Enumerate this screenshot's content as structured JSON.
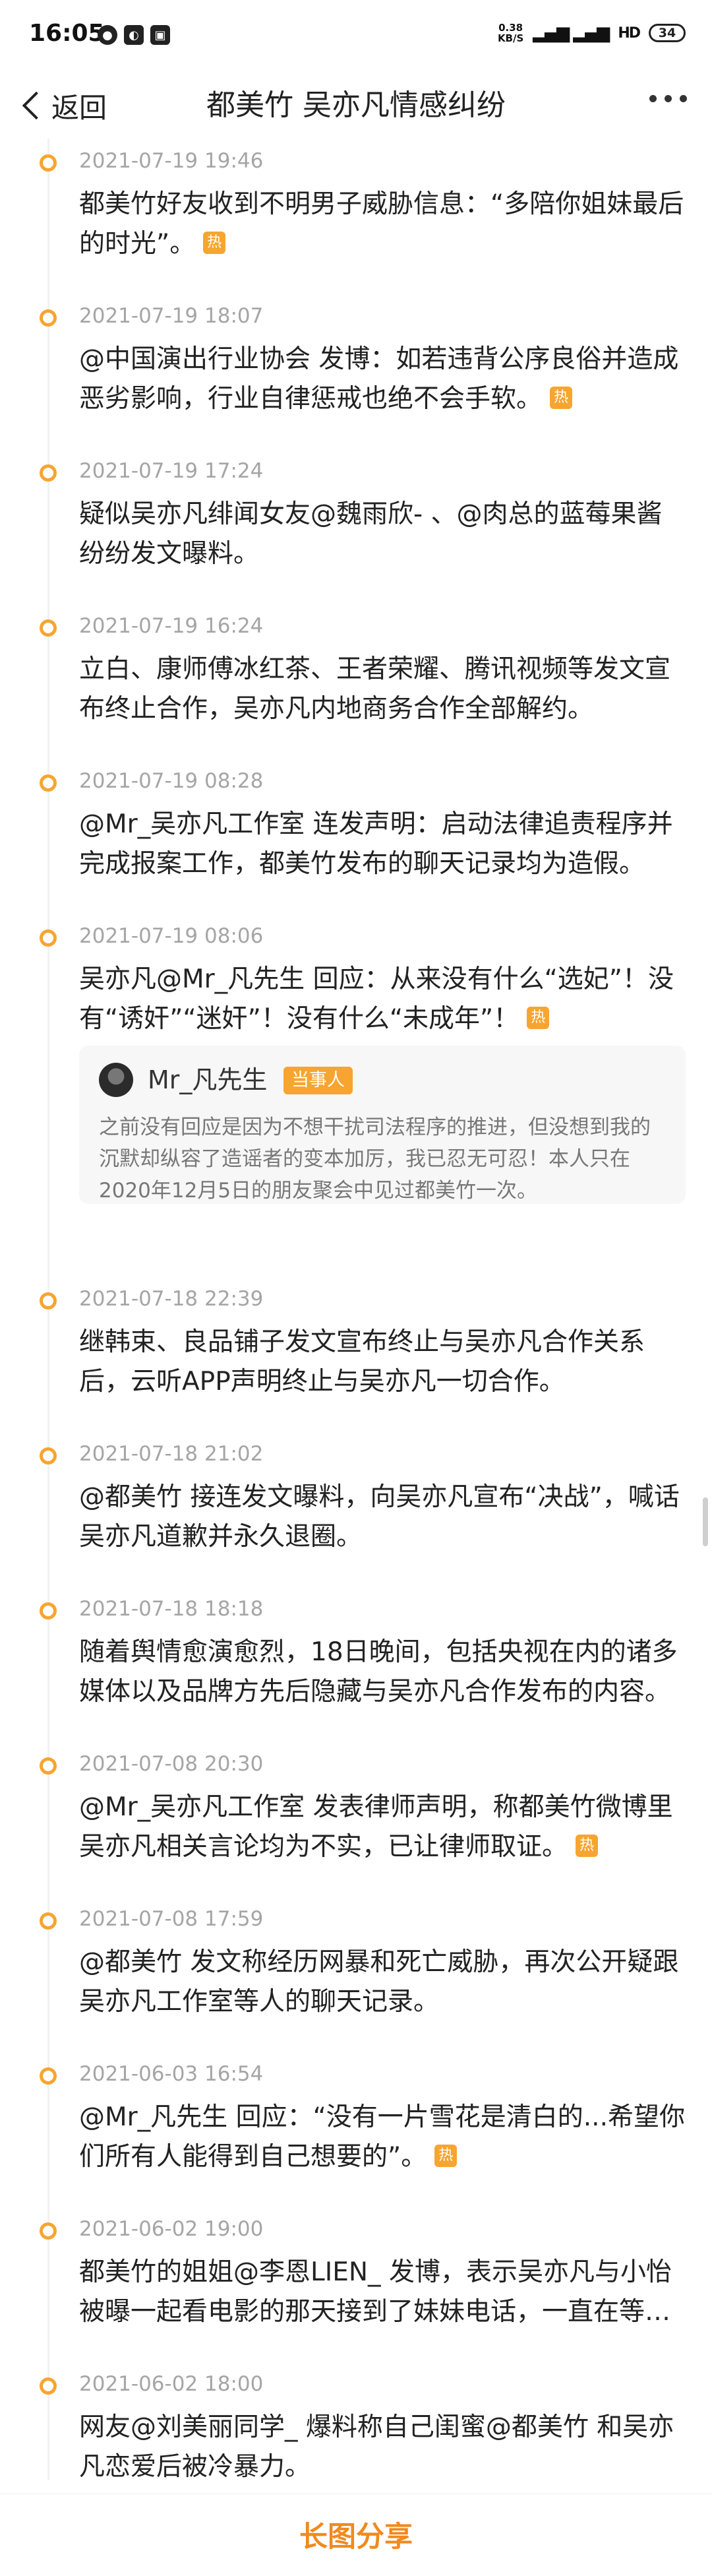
{
  "status_bar": {
    "time": "16:05",
    "left_icons": [
      "message-icon",
      "dnd-icon",
      "app-icon"
    ],
    "speed_value": "0.38",
    "speed_unit": "KB/S",
    "signal": "4G 4G",
    "wifi_label": "HD",
    "battery": "34"
  },
  "nav": {
    "back_label": "返回",
    "title": "都美竹 吴亦凡情感纠纷"
  },
  "hot_label": "热",
  "timeline": [
    {
      "time": "2021-07-19 19:46",
      "text": "都美竹好友收到不明男子威胁信息：“多陪你姐妹最后的时光”。",
      "hot": true
    },
    {
      "time": "2021-07-19 18:07",
      "text": "@中国演出行业协会 发博：如若违背公序良俗并造成恶劣影响，行业自律惩戒也绝不会手软。",
      "hot": true
    },
    {
      "time": "2021-07-19 17:24",
      "text": "疑似吴亦凡绯闻女友@魏雨欣- 、@肉总的蓝莓果酱 纷纷发文曝料。",
      "hot": false
    },
    {
      "time": "2021-07-19 16:24",
      "text": "立白、康师傅冰红茶、王者荣耀、腾讯视频等发文宣布终止合作，吴亦凡内地商务合作全部解约。",
      "hot": false
    },
    {
      "time": "2021-07-19 08:28",
      "text": "@Mr_吴亦凡工作室 连发声明：启动法律追责程序并完成报案工作，都美竹发布的聊天记录均为造假。",
      "hot": false
    },
    {
      "time": "2021-07-19 08:06",
      "text": "吴亦凡@Mr_凡先生 回应：从来没有什么“选妃”！没有“诱奸”“迷奸”！没有什么“未成年”！",
      "hot": true,
      "quote": {
        "name": "Mr_凡先生",
        "badge": "当事人",
        "text": "之前没有回应是因为不想干扰司法程序的推进，但没想到我的沉默却纵容了造谣者的变本加厉，我已忍无可忍！本人只在2020年12月5日的朋友聚会中见过都美竹一次。"
      }
    },
    {
      "time": "2021-07-18 22:39",
      "text": "继韩束、良品铺子发文宣布终止与吴亦凡合作关系后，云听APP声明终止与吴亦凡一切合作。",
      "hot": false
    },
    {
      "time": "2021-07-18 21:02",
      "text": "@都美竹 接连发文曝料，向吴亦凡宣布“决战”，喊话吴亦凡道歉并永久退圈。",
      "hot": false
    },
    {
      "time": "2021-07-18 18:18",
      "text": "随着舆情愈演愈烈，18日晚间，包括央视在内的诸多媒体以及品牌方先后隐藏与吴亦凡合作发布的内容。",
      "hot": false
    },
    {
      "time": "2021-07-08 20:30",
      "text": "@Mr_吴亦凡工作室 发表律师声明，称都美竹微博里吴亦凡相关言论均为不实，已让律师取证。",
      "hot": true
    },
    {
      "time": "2021-07-08 17:59",
      "text": "@都美竹 发文称经历网暴和死亡威胁，再次公开疑跟吴亦凡工作室等人的聊天记录。",
      "hot": false
    },
    {
      "time": "2021-06-03 16:54",
      "text": "@Mr_凡先生 回应：“没有一片雪花是清白的...希望你们所有人能得到自己想要的”。",
      "hot": true
    },
    {
      "time": "2021-06-02 19:00",
      "text": "都美竹的姐姐@李恩LIEN_ 发博，表示吴亦凡与小怡被曝一起看电影的那天接到了妹妹电话，一直在等她。",
      "hot": false
    },
    {
      "time": "2021-06-02 18:00",
      "text": "网友@刘美丽同学_ 爆料称自己闺蜜@都美竹 和吴亦凡恋爱后被冷暴力。",
      "hot": false
    }
  ],
  "share_label": "长图分享"
}
